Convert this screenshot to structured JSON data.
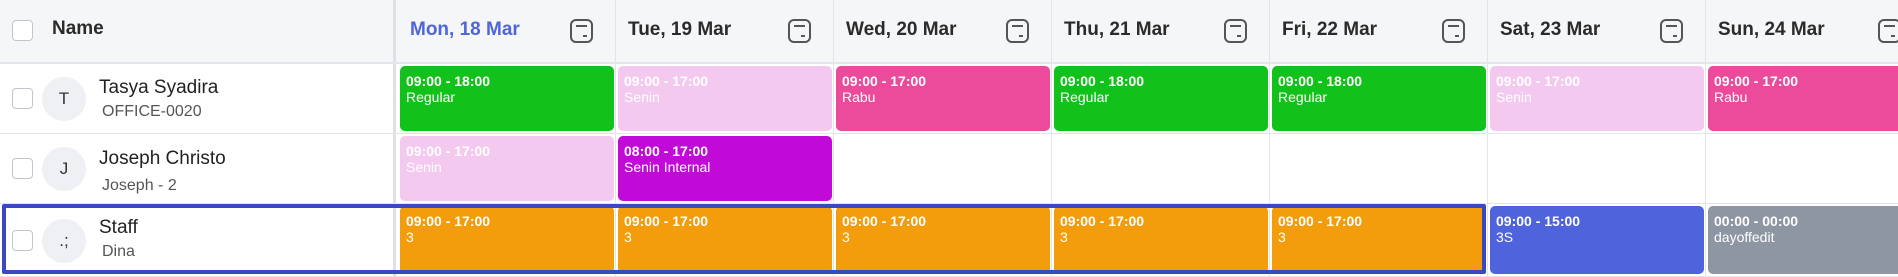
{
  "header": {
    "name_label": "Name",
    "days": [
      {
        "label": "Mon, 18 Mar",
        "today": true
      },
      {
        "label": "Tue, 19 Mar",
        "today": false
      },
      {
        "label": "Wed, 20 Mar",
        "today": false
      },
      {
        "label": "Thu, 21 Mar",
        "today": false
      },
      {
        "label": "Fri, 22 Mar",
        "today": false
      },
      {
        "label": "Sat, 23 Mar",
        "today": false
      },
      {
        "label": "Sun, 24 Mar",
        "today": false
      }
    ]
  },
  "colors": {
    "regular": "#12c11a",
    "senin": "#f4c9ef",
    "rabu": "#ec4a9a",
    "senin_internal": "#c20ad8",
    "three": "#f39c0c",
    "three_s": "#4f64dc",
    "dayoff": "#8e95a3",
    "today_accent": "#4e66d8",
    "selection": "#3b47c3"
  },
  "rows": [
    {
      "avatar": "T",
      "name": "Tasya Syadira",
      "code": "OFFICE-0020",
      "shifts": [
        {
          "time": "09:00 - 18:00",
          "label": "Regular",
          "color": "#12c11a"
        },
        {
          "time": "09:00 - 17:00",
          "label": "Senin",
          "color": "#f4c9ef"
        },
        {
          "time": "09:00 - 17:00",
          "label": "Rabu",
          "color": "#ec4a9a"
        },
        {
          "time": "09:00 - 18:00",
          "label": "Regular",
          "color": "#12c11a"
        },
        {
          "time": "09:00 - 18:00",
          "label": "Regular",
          "color": "#12c11a"
        },
        {
          "time": "09:00 - 17:00",
          "label": "Senin",
          "color": "#f4c9ef"
        },
        {
          "time": "09:00 - 17:00",
          "label": "Rabu",
          "color": "#ec4a9a"
        }
      ]
    },
    {
      "avatar": "J",
      "name": "Joseph Christo",
      "code": "Joseph - 2",
      "shifts": [
        {
          "time": "09:00 - 17:00",
          "label": "Senin",
          "color": "#f4c9ef"
        },
        {
          "time": "08:00 - 17:00",
          "label": "Senin Internal",
          "color": "#c20ad8"
        },
        null,
        null,
        null,
        null,
        null
      ]
    },
    {
      "avatar": ".;",
      "name": "Staff",
      "code": "Dina",
      "selected": true,
      "shifts": [
        {
          "time": "09:00 - 17:00",
          "label": "3",
          "color": "#f39c0c"
        },
        {
          "time": "09:00 - 17:00",
          "label": "3",
          "color": "#f39c0c"
        },
        {
          "time": "09:00 - 17:00",
          "label": "3",
          "color": "#f39c0c"
        },
        {
          "time": "09:00 - 17:00",
          "label": "3",
          "color": "#f39c0c"
        },
        {
          "time": "09:00 - 17:00",
          "label": "3",
          "color": "#f39c0c"
        },
        {
          "time": "09:00 - 15:00",
          "label": "3S",
          "color": "#4f64dc"
        },
        {
          "time": "00:00 - 00:00",
          "label": "dayoffedit",
          "color": "#8e95a3"
        }
      ]
    }
  ]
}
